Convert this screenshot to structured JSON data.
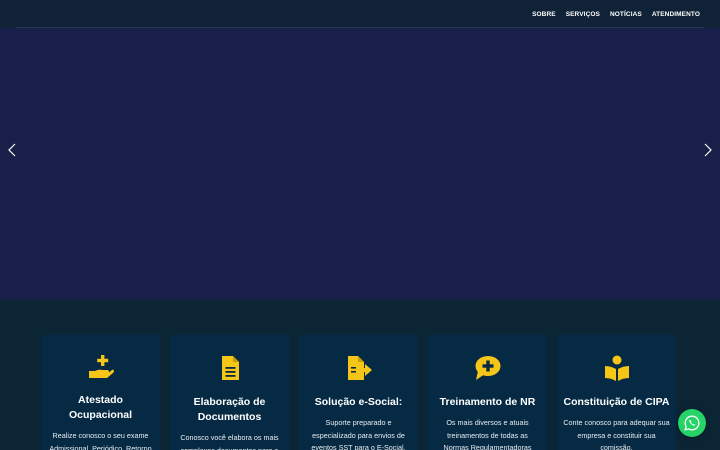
{
  "nav": {
    "items": [
      {
        "label": "SOBRE"
      },
      {
        "label": "SERVIÇOS"
      },
      {
        "label": "NOTÍCIAS"
      },
      {
        "label": "ATENDIMENTO"
      }
    ]
  },
  "slider": {
    "prev_icon": "chevron-left-icon",
    "next_icon": "chevron-right-icon"
  },
  "services": {
    "accent_color": "#f5c518",
    "cards": [
      {
        "icon": "hand-medical-icon",
        "title": "Atestado Ocupacional",
        "text": "Realize conosco o seu exame Admissional, Periódico, Retorno ao Trabalho, Mudança de Risco"
      },
      {
        "icon": "document-icon",
        "title": "Elaboração de Documentos",
        "text": "Conosco você elabora os mais complexos documentos para a"
      },
      {
        "icon": "file-export-icon",
        "title": "Solução e-Social:",
        "text": "Suporte preparado e especializado para envios de eventos SST para o E-Social."
      },
      {
        "icon": "comment-medical-icon",
        "title": "Treinamento de NR",
        "text": "Os mais diversos e atuais treinamentos de todas as Normas Regulamentadoras"
      },
      {
        "icon": "book-reader-icon",
        "title": "Constituição de CIPA",
        "text": "Conte conosco para adequar sua empresa e constituir sua comissão."
      }
    ]
  },
  "whatsapp": {
    "icon": "whatsapp-icon",
    "color": "#25d366"
  }
}
